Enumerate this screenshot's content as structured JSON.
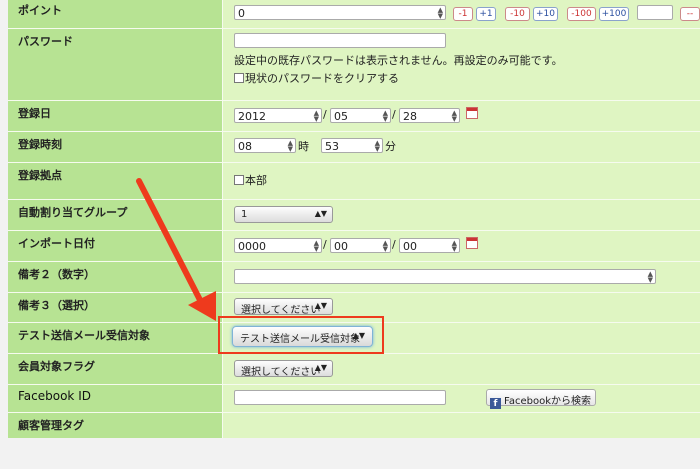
{
  "rows": {
    "points": {
      "label": "ポイント",
      "value": "0",
      "buttons": [
        "-1",
        "+1",
        "-10",
        "+10",
        "-100",
        "+100"
      ],
      "extra_button": "--"
    },
    "password": {
      "label": "パスワード",
      "value": "",
      "note": "設定中の既存パスワードは表示されません。再設定のみ可能です。",
      "clear_label": "現状のパスワードをクリアする"
    },
    "reg_date": {
      "label": "登録日",
      "year": "2012",
      "month": "05",
      "day": "28",
      "sep": "/"
    },
    "reg_time": {
      "label": "登録時刻",
      "hour": "08",
      "hour_unit": "時",
      "minute": "53",
      "minute_unit": "分"
    },
    "reg_location": {
      "label": "登録拠点",
      "option": "本部"
    },
    "auto_group": {
      "label": "自動割り当てグループ",
      "value": "1"
    },
    "import_date": {
      "label": "インポート日付",
      "year": "0000",
      "month": "00",
      "day": "00",
      "sep": "/"
    },
    "note2": {
      "label": "備考２（数字）",
      "value": ""
    },
    "note3": {
      "label": "備考３（選択）",
      "value": "選択してください"
    },
    "test_mail": {
      "label": "テスト送信メール受信対象",
      "value": "テスト送信メール受信対象"
    },
    "member_flag": {
      "label": "会員対象フラグ",
      "value": "選択してください"
    },
    "facebook": {
      "label": "Facebook ID",
      "value": "",
      "search_button": "Facebookから検索",
      "icon_letter": "f"
    },
    "customer_tag": {
      "label": "顧客管理タグ"
    }
  },
  "colors": {
    "label_bg": "#b7e393",
    "field_bg": "#dff5c2",
    "highlight": "#ee3a1d"
  },
  "icons": [
    "calendar-icon",
    "facebook-icon",
    "arrow-icon",
    "spinner-icon"
  ]
}
